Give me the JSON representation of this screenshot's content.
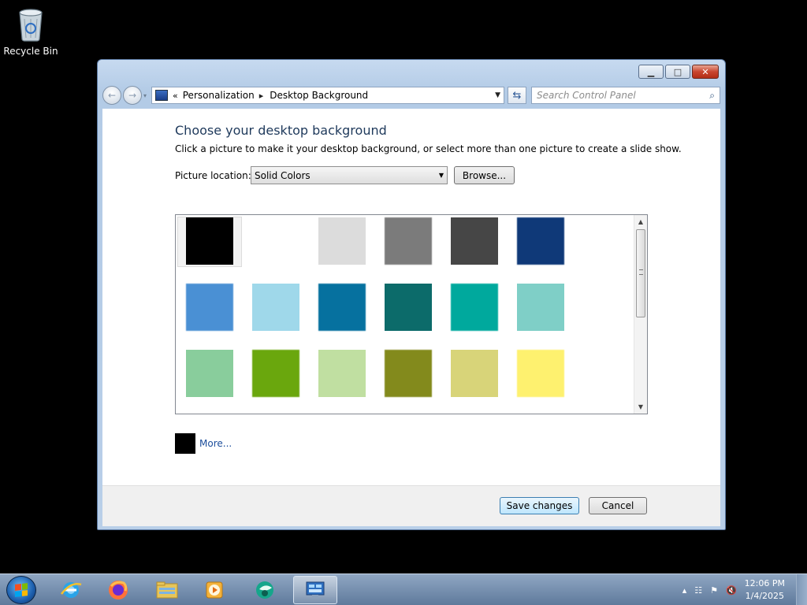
{
  "desktop": {
    "icons": [
      {
        "label": "Recycle Bin",
        "icon": "recycle-bin-icon"
      }
    ]
  },
  "window": {
    "controls": {
      "minimize": "minimize-icon",
      "maximize": "maximize-icon",
      "close": "close-icon"
    },
    "nav": {
      "back": "back-arrow-icon",
      "forward": "forward-arrow-icon",
      "breadcrumb": [
        "Personalization",
        "Desktop Background"
      ],
      "search_placeholder": "Search Control Panel"
    },
    "content": {
      "title": "Choose your desktop background",
      "description": "Click a picture to make it your desktop background, or select more than one picture to create a slide show.",
      "location_label": "Picture location:",
      "location_value": "Solid Colors",
      "browse_label": "Browse...",
      "swatches": [
        [
          "#000000",
          "#ffffff",
          "#dcdcdc",
          "#7b7b7b",
          "#464646",
          "#0f3978"
        ],
        [
          "#4a90d4",
          "#9fd8ea",
          "#06719f",
          "#0c6b6a",
          "#00a99d",
          "#7fcfc7"
        ],
        [
          "#89cd9c",
          "#6aa70d",
          "#c0dfa1",
          "#838a1c",
          "#d8d479",
          "#fef16f"
        ]
      ],
      "selected_swatch": "#000000",
      "more_label": "More..."
    },
    "footer": {
      "save_label": "Save changes",
      "cancel_label": "Cancel"
    }
  },
  "taskbar": {
    "pinned": [
      "internet-explorer-icon",
      "firefox-icon",
      "file-explorer-icon",
      "media-player-icon",
      "app-icon",
      "control-panel-icon"
    ],
    "clock": {
      "time": "12:06 PM",
      "date": "1/4/2025"
    }
  }
}
